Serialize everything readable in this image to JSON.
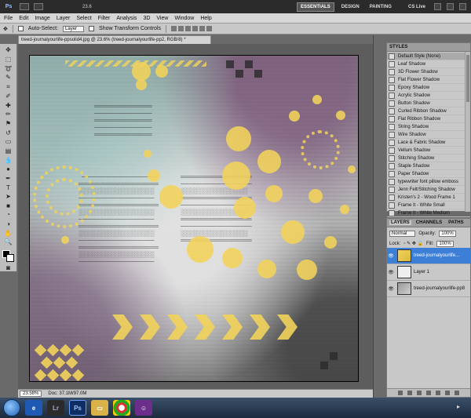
{
  "appbar": {
    "logo": "Ps",
    "zoom": "23.6",
    "workspaces": [
      "ESSENTIALS",
      "DESIGN",
      "PAINTING"
    ],
    "active_workspace": "ESSENTIALS",
    "cs_live": "CS Live"
  },
  "menu": [
    "File",
    "Edit",
    "Image",
    "Layer",
    "Select",
    "Filter",
    "Analysis",
    "3D",
    "View",
    "Window",
    "Help"
  ],
  "options": {
    "auto_select": "Auto-Select:",
    "layer_value": "Layer",
    "transform": "Show Transform Controls"
  },
  "document": {
    "tab_title": "treed-journalyourlife-ppsolid4.jpg @ 23.6% (treed-journalyourlife-pp2, RGB/8) *",
    "zoom": "23.58%",
    "doc_size": "Doc: 37.1M/97.0M"
  },
  "styles_panel": {
    "title": "STYLES",
    "items": [
      "Default Style (None)",
      "Leaf Shadow",
      "3D Flower Shadow",
      "Flat Flower Shadow",
      "Epoxy Shadow",
      "Acrylic Shadow",
      "Button Shadow",
      "Curled Ribbon Shadow",
      "Flat Ribbon Shadow",
      "String Shadow",
      "Wire Shadow",
      "Lace & Fabric Shadow",
      "Vellum Shadow",
      "Stitching Shadow",
      "Staple Shadow",
      "Paper Shadow",
      "typewriter font pillow emboss",
      "Jenn Felt/Stitching Shadow",
      "Kristen's 2 - Wood Frame 1",
      "Frame It - White Small",
      "Frame It - White Medium"
    ]
  },
  "layers_panel": {
    "tabs": [
      "LAYERS",
      "CHANNELS",
      "PATHS"
    ],
    "blend_mode": "Normal",
    "opacity_label": "Opacity:",
    "opacity": "100%",
    "lock_label": "Lock:",
    "fill_label": "Fill:",
    "fill": "100%",
    "layers": [
      {
        "name": "treed-journalyourlife...",
        "active": true
      },
      {
        "name": "Layer 1",
        "active": false
      },
      {
        "name": "treed-journalyourlife-pp8",
        "active": false
      }
    ]
  },
  "taskbar": {
    "items": [
      "Lr",
      "Ps"
    ]
  }
}
